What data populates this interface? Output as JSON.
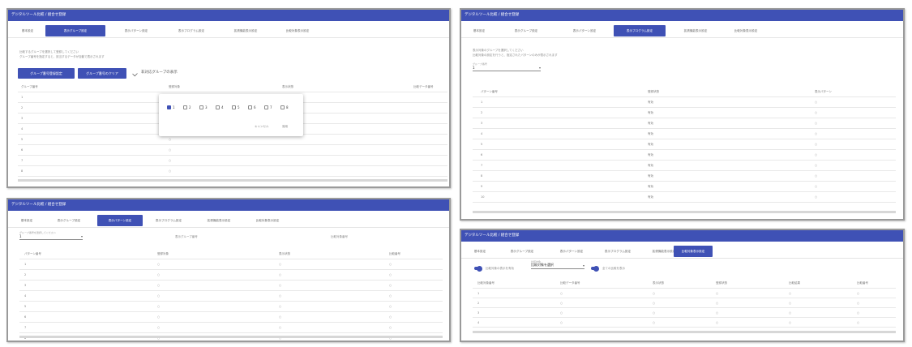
{
  "app_title": "デジタルツール比較 / 組合せ登録",
  "tabs": [
    "基本設定",
    "表示グループ設定",
    "表示パターン設定",
    "表示プログラム設定",
    "拡張機能表示設定",
    "比較対象表示設定"
  ],
  "win1": {
    "desc": [
      "比較するグループを選択して登録してください",
      "グループ番号を指定すると、該当するデータが自動で表示されます"
    ],
    "btn_primary": "グループ番号登録設定",
    "btn_secondary": "グループ番号のクリア",
    "toggle_label": "非対応グループの表示",
    "columns": [
      "グループ番号",
      "登録対象",
      "表示状態",
      "比較データ番号"
    ],
    "rows": [
      "1",
      "2",
      "3",
      "4",
      "5",
      "6",
      "7",
      "8"
    ],
    "row_marks": [
      "",
      "",
      "",
      "",
      "○",
      "○",
      "○",
      "○"
    ],
    "popup_nums": [
      "1",
      "2",
      "3",
      "4",
      "5",
      "6",
      "7",
      "8"
    ],
    "popup_cancel": "キャンセル",
    "popup_ok": "適用"
  },
  "win2": {
    "desc": [
      "表示対象のグループを選択してください",
      "比較対象の設定を行うと、指定されたパターンのみが表示されます"
    ],
    "select_label": "グループ番号",
    "select_value": "1",
    "columns": [
      "パターン番号",
      "登録状態",
      "表示パターン"
    ],
    "rows": [
      [
        "1",
        "有効",
        "○"
      ],
      [
        "2",
        "有効",
        "○"
      ],
      [
        "3",
        "有効",
        "○"
      ],
      [
        "4",
        "有効",
        "○"
      ],
      [
        "5",
        "有効",
        "○"
      ],
      [
        "6",
        "有効",
        "○"
      ],
      [
        "7",
        "有効",
        "○"
      ],
      [
        "8",
        "有効",
        "○"
      ],
      [
        "9",
        "有効",
        "○"
      ],
      [
        "10",
        "有効",
        "○"
      ]
    ]
  },
  "win3": {
    "select_label": "グループ番号を選択してください",
    "select_value": "1",
    "info_a": "表示グループ番号",
    "info_b": "比較対象番号",
    "columns": [
      "パターン番号",
      "登録対象",
      "表示状態",
      "比較番号"
    ],
    "rows": [
      "1",
      "2",
      "3",
      "4",
      "5",
      "6",
      "7",
      "8"
    ],
    "cell": "○"
  },
  "win4": {
    "toggle1_label": "比較対象の表示を有効",
    "select_label": "比較対象",
    "select_value": "比較対象を選択",
    "toggle2_label": "全ての比較を表示",
    "columns": [
      "比較対象番号",
      "比較データ番号",
      "表示状態",
      "登録状態",
      "比較結果",
      "比較番号"
    ],
    "rows": [
      "1",
      "2",
      "3",
      "4"
    ],
    "cell": "○"
  }
}
